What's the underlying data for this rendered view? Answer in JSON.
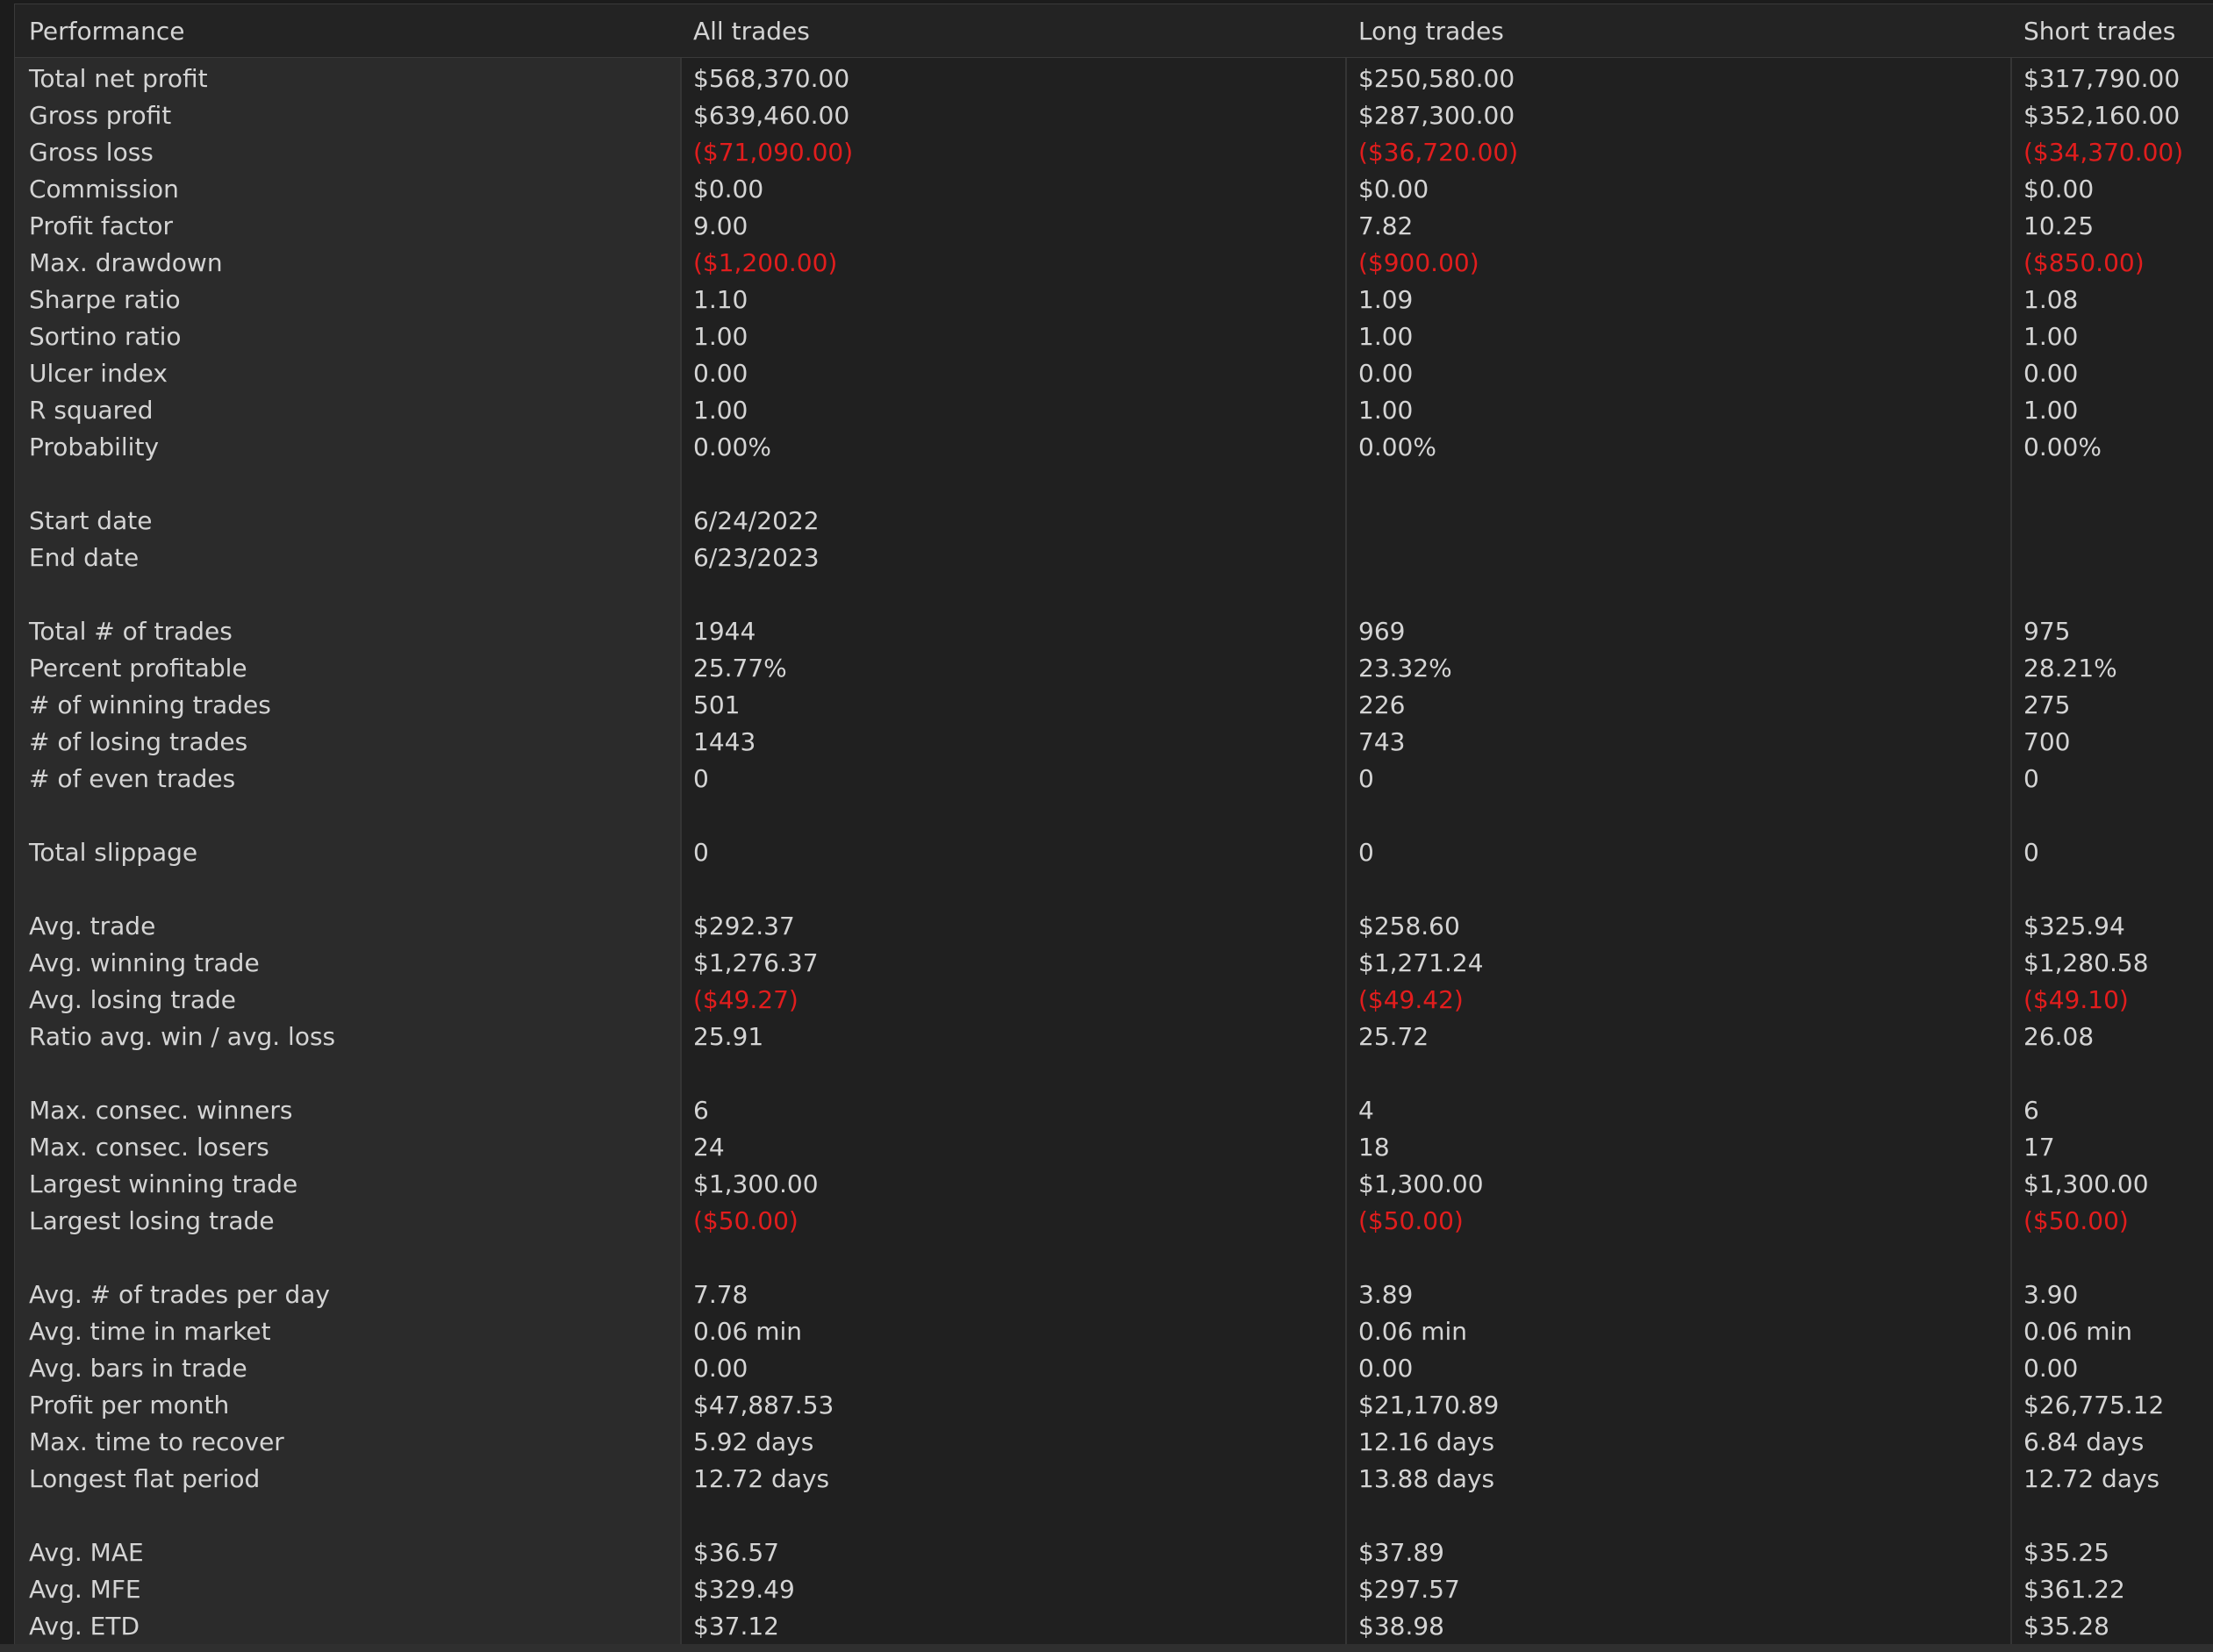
{
  "header": {
    "col0": "Performance",
    "col1": "All trades",
    "col2": "Long trades",
    "col3": "Short trades"
  },
  "colors": {
    "negative": "#e11d1d",
    "text": "#d4d4d4",
    "background": "#202020",
    "label_column": "#2b2b2b"
  },
  "rows": [
    {
      "label": "Total net profit",
      "all": "$568,370.00",
      "long": "$250,580.00",
      "short": "$317,790.00",
      "neg": false
    },
    {
      "label": "Gross profit",
      "all": "$639,460.00",
      "long": "$287,300.00",
      "short": "$352,160.00",
      "neg": false
    },
    {
      "label": "Gross loss",
      "all": "($71,090.00)",
      "long": "($36,720.00)",
      "short": "($34,370.00)",
      "neg": true
    },
    {
      "label": "Commission",
      "all": "$0.00",
      "long": "$0.00",
      "short": "$0.00",
      "neg": false
    },
    {
      "label": "Profit factor",
      "all": "9.00",
      "long": "7.82",
      "short": "10.25",
      "neg": false
    },
    {
      "label": "Max. drawdown",
      "all": "($1,200.00)",
      "long": "($900.00)",
      "short": "($850.00)",
      "neg": true
    },
    {
      "label": "Sharpe ratio",
      "all": "1.10",
      "long": "1.09",
      "short": "1.08",
      "neg": false
    },
    {
      "label": "Sortino ratio",
      "all": "1.00",
      "long": "1.00",
      "short": "1.00",
      "neg": false
    },
    {
      "label": "Ulcer index",
      "all": "0.00",
      "long": "0.00",
      "short": "0.00",
      "neg": false
    },
    {
      "label": "R squared",
      "all": "1.00",
      "long": "1.00",
      "short": "1.00",
      "neg": false
    },
    {
      "label": "Probability",
      "all": "0.00%",
      "long": "0.00%",
      "short": "0.00%",
      "neg": false
    },
    {
      "spacer": true
    },
    {
      "label": "Start date",
      "all": "6/24/2022",
      "long": "",
      "short": "",
      "neg": false
    },
    {
      "label": "End date",
      "all": "6/23/2023",
      "long": "",
      "short": "",
      "neg": false
    },
    {
      "spacer": true
    },
    {
      "label": "Total # of trades",
      "all": "1944",
      "long": "969",
      "short": "975",
      "neg": false
    },
    {
      "label": "Percent profitable",
      "all": "25.77%",
      "long": "23.32%",
      "short": "28.21%",
      "neg": false
    },
    {
      "label": "# of winning trades",
      "all": "501",
      "long": "226",
      "short": "275",
      "neg": false
    },
    {
      "label": "# of losing trades",
      "all": "1443",
      "long": "743",
      "short": "700",
      "neg": false
    },
    {
      "label": "# of even trades",
      "all": "0",
      "long": "0",
      "short": "0",
      "neg": false
    },
    {
      "spacer": true
    },
    {
      "label": "Total slippage",
      "all": "0",
      "long": "0",
      "short": "0",
      "neg": false
    },
    {
      "spacer": true
    },
    {
      "label": "Avg. trade",
      "all": "$292.37",
      "long": "$258.60",
      "short": "$325.94",
      "neg": false
    },
    {
      "label": "Avg. winning trade",
      "all": "$1,276.37",
      "long": "$1,271.24",
      "short": "$1,280.58",
      "neg": false
    },
    {
      "label": "Avg. losing trade",
      "all": "($49.27)",
      "long": "($49.42)",
      "short": "($49.10)",
      "neg": true
    },
    {
      "label": "Ratio avg. win / avg. loss",
      "all": "25.91",
      "long": "25.72",
      "short": "26.08",
      "neg": false
    },
    {
      "spacer": true
    },
    {
      "label": "Max. consec. winners",
      "all": "6",
      "long": "4",
      "short": "6",
      "neg": false
    },
    {
      "label": "Max. consec. losers",
      "all": "24",
      "long": "18",
      "short": "17",
      "neg": false
    },
    {
      "label": "Largest winning trade",
      "all": "$1,300.00",
      "long": "$1,300.00",
      "short": "$1,300.00",
      "neg": false
    },
    {
      "label": "Largest losing trade",
      "all": "($50.00)",
      "long": "($50.00)",
      "short": "($50.00)",
      "neg": true
    },
    {
      "spacer": true
    },
    {
      "label": "Avg. # of trades per day",
      "all": "7.78",
      "long": "3.89",
      "short": "3.90",
      "neg": false
    },
    {
      "label": "Avg. time in market",
      "all": "0.06 min",
      "long": "0.06 min",
      "short": "0.06 min",
      "neg": false
    },
    {
      "label": "Avg. bars in trade",
      "all": "0.00",
      "long": "0.00",
      "short": "0.00",
      "neg": false
    },
    {
      "label": "Profit per month",
      "all": "$47,887.53",
      "long": "$21,170.89",
      "short": "$26,775.12",
      "neg": false
    },
    {
      "label": "Max. time to recover",
      "all": "5.92 days",
      "long": "12.16 days",
      "short": "6.84 days",
      "neg": false
    },
    {
      "label": "Longest flat period",
      "all": "12.72 days",
      "long": "13.88 days",
      "short": "12.72 days",
      "neg": false
    },
    {
      "spacer": true
    },
    {
      "label": "Avg. MAE",
      "all": "$36.57",
      "long": "$37.89",
      "short": "$35.25",
      "neg": false
    },
    {
      "label": "Avg. MFE",
      "all": "$329.49",
      "long": "$297.57",
      "short": "$361.22",
      "neg": false
    },
    {
      "label": "Avg. ETD",
      "all": "$37.12",
      "long": "$38.98",
      "short": "$35.28",
      "neg": false
    }
  ]
}
